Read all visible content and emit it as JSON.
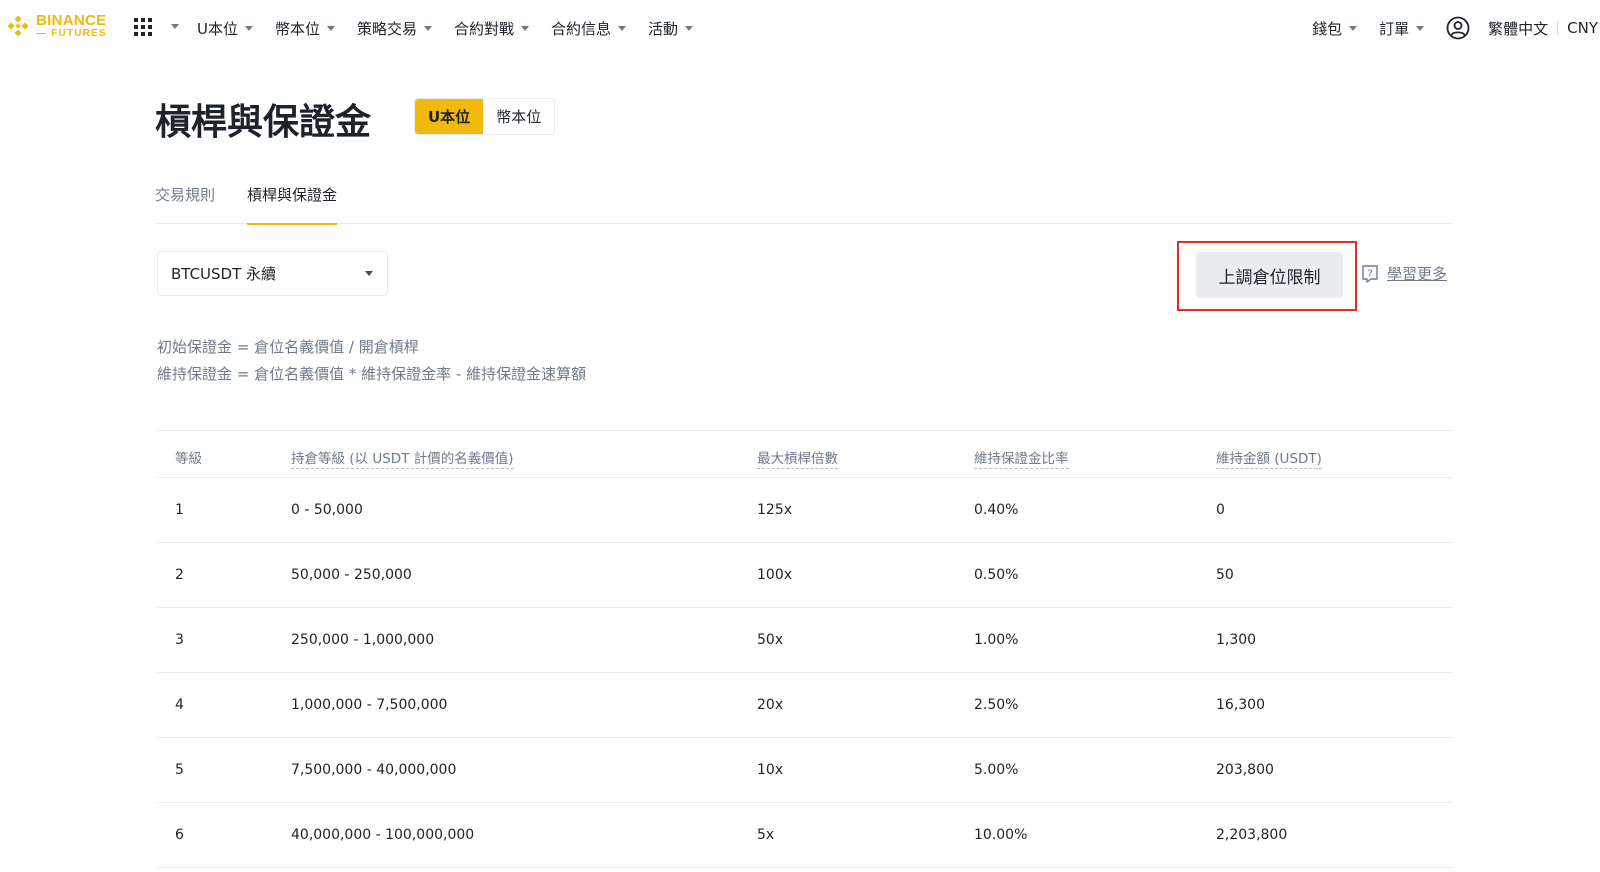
{
  "brand": {
    "name": "BINANCE",
    "sub": "— FUTURES",
    "color": "#F0B90B"
  },
  "nav": {
    "items": [
      "U本位",
      "幣本位",
      "策略交易",
      "合約對戰",
      "合約信息",
      "活動"
    ],
    "right": {
      "wallet": "錢包",
      "orders": "訂單",
      "language": "繁體中文",
      "currency": "CNY"
    }
  },
  "page": {
    "title": "槓桿與保證金",
    "segment": {
      "active": "U本位",
      "inactive": "幣本位"
    },
    "tabs": [
      "交易規則",
      "槓桿與保證金"
    ],
    "active_tab": "槓桿與保證金"
  },
  "controls": {
    "symbol_select": "BTCUSDT 永續",
    "raise_button": "上調倉位限制",
    "learn_more": "學習更多"
  },
  "formulas": {
    "initial": "初始保證金 = 倉位名義價值 / 開倉槓桿",
    "maintenance": "維持保證金 = 倉位名義價值 * 維持保證金率 - 維持保證金速算額"
  },
  "table": {
    "headers": [
      "等級",
      "持倉等級 (以 USDT 計價的名義價值)",
      "最大槓桿倍數",
      "維持保證金比率",
      "維持金額 (USDT)"
    ],
    "rows": [
      [
        "1",
        "0 - 50,000",
        "125x",
        "0.40%",
        "0"
      ],
      [
        "2",
        "50,000 - 250,000",
        "100x",
        "0.50%",
        "50"
      ],
      [
        "3",
        "250,000 - 1,000,000",
        "50x",
        "1.00%",
        "1,300"
      ],
      [
        "4",
        "1,000,000 - 7,500,000",
        "20x",
        "2.50%",
        "16,300"
      ],
      [
        "5",
        "7,500,000 - 40,000,000",
        "10x",
        "5.00%",
        "203,800"
      ],
      [
        "6",
        "40,000,000 - 100,000,000",
        "5x",
        "10.00%",
        "2,203,800"
      ]
    ]
  },
  "icons": {
    "logo": "binance-logo-icon",
    "apps": "grid-icon",
    "user": "user-circle-icon",
    "help": "help-icon"
  },
  "colors": {
    "accent": "#F0B90B",
    "highlight_border": "#E03127",
    "muted_text": "#707A8A"
  }
}
